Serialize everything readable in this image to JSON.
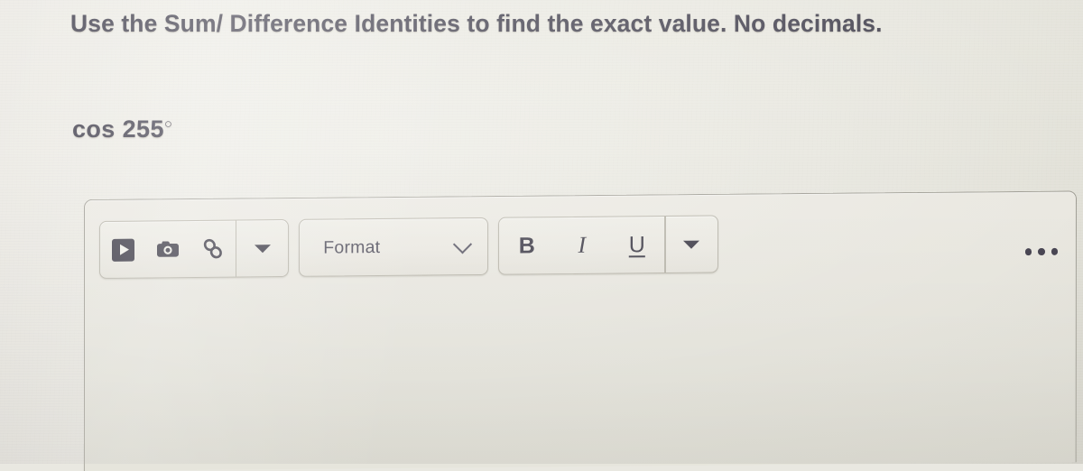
{
  "page": {
    "prompt": "Use the Sum/ Difference Identities to find the exact value. No decimals.",
    "expression_base": "cos 255",
    "expression_degree": "○",
    "text_color": "#3f3d4b",
    "background_color": "#eae9e2"
  },
  "editor": {
    "toolbar": {
      "groups": [
        {
          "name": "insert-group",
          "buttons": [
            {
              "name": "insert-video",
              "icon": "video-icon"
            },
            {
              "name": "insert-image",
              "icon": "camera-icon"
            },
            {
              "name": "insert-link",
              "icon": "link-icon"
            },
            {
              "name": "insert-more",
              "icon": "caret-down-icon"
            }
          ]
        },
        {
          "name": "format-group",
          "label": "Format",
          "icon": "chevron-down-icon"
        },
        {
          "name": "text-style-group",
          "buttons": [
            {
              "name": "bold",
              "label": "B"
            },
            {
              "name": "italic",
              "label": "I"
            },
            {
              "name": "underline",
              "label": "U"
            },
            {
              "name": "text-style-more",
              "icon": "caret-down-icon"
            }
          ]
        }
      ],
      "overflow": {
        "name": "more-options",
        "icon": "ellipsis-icon",
        "label": "•••"
      }
    }
  }
}
